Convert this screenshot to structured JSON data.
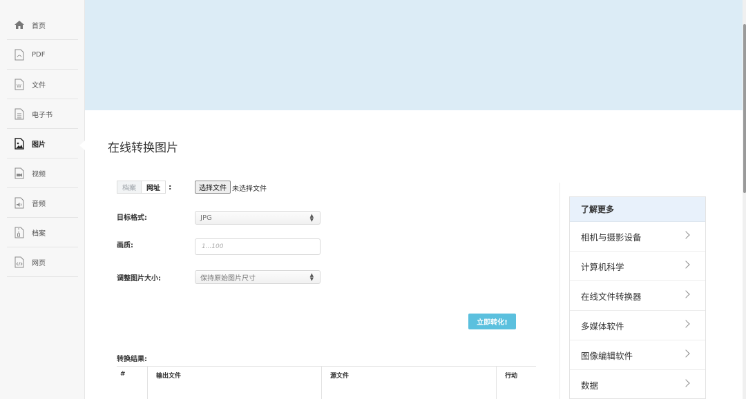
{
  "sidebar": {
    "items": [
      {
        "label": "首页",
        "icon": "home-icon"
      },
      {
        "label": "PDF",
        "icon": "pdf-file-icon"
      },
      {
        "label": "文件",
        "icon": "word-file-icon"
      },
      {
        "label": "电子书",
        "icon": "ebook-icon"
      },
      {
        "label": "图片",
        "icon": "image-icon",
        "active": true
      },
      {
        "label": "视频",
        "icon": "video-file-icon"
      },
      {
        "label": "音频",
        "icon": "audio-file-icon"
      },
      {
        "label": "档案",
        "icon": "archive-file-icon"
      },
      {
        "label": "网页",
        "icon": "code-file-icon"
      }
    ]
  },
  "page": {
    "title": "在线转换图片"
  },
  "form": {
    "source_tabs": [
      "档案",
      "网址"
    ],
    "colon": ":",
    "file_button": "选择文件",
    "file_status": "未选择文件",
    "target_format_label": "目标格式:",
    "target_format_value": "JPG",
    "quality_label": "画质:",
    "quality_placeholder": "1...100",
    "resize_label": "调整图片大小:",
    "resize_value": "保持原始图片尺寸",
    "convert_button": "立即转化!"
  },
  "results": {
    "label": "转换结果:",
    "columns": [
      "#",
      "输出文件",
      "源文件",
      "行动"
    ]
  },
  "learn_more": {
    "title": "了解更多",
    "items": [
      "相机与摄影设备",
      "计算机科学",
      "在线文件转换器",
      "多媒体软件",
      "图像编辑软件",
      "数据"
    ]
  },
  "colors": {
    "banner": "#dcecf6",
    "convert_button": "#5bc0de",
    "panel_header": "#e8f1fb"
  }
}
